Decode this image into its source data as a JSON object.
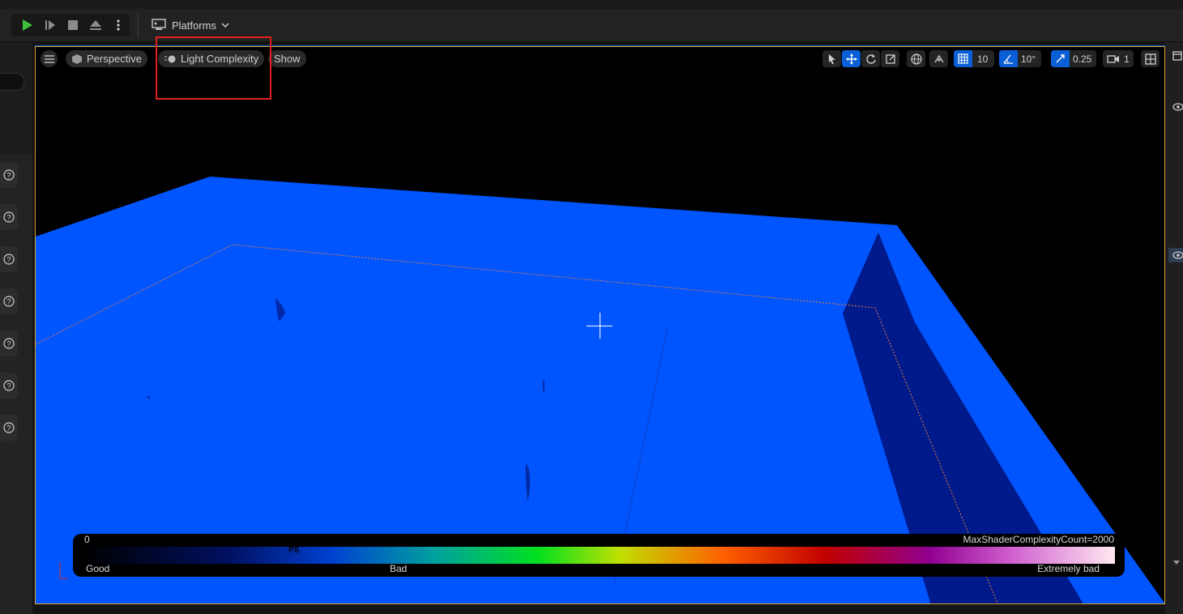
{
  "toolbar": {
    "platforms_label": "Platforms",
    "icons": [
      "play-icon",
      "step-icon",
      "stop-icon",
      "eject-icon",
      "more-icon",
      "gamepad-icon",
      "chevron-down-icon"
    ]
  },
  "viewport": {
    "menu_icon": "hamburger-icon",
    "perspective_label": "Perspective",
    "view_mode_label": "Light Complexity",
    "show_label": "Show",
    "grid_snap_value": "10",
    "rotation_snap_value": "10°",
    "scale_snap_value": "0.25",
    "camera_speed_value": "1"
  },
  "legend": {
    "min_label": "0",
    "max_label": "MaxShaderComplexityCount=2000",
    "good_label": "Good",
    "bad_label": "Bad",
    "extremely_bad_label": "Extremely bad",
    "marker_label": "PS"
  },
  "colors": {
    "floor": "#0055ff",
    "wall": "#001a8c",
    "accent": "#0a5fd6",
    "highlight": "#e02020"
  }
}
